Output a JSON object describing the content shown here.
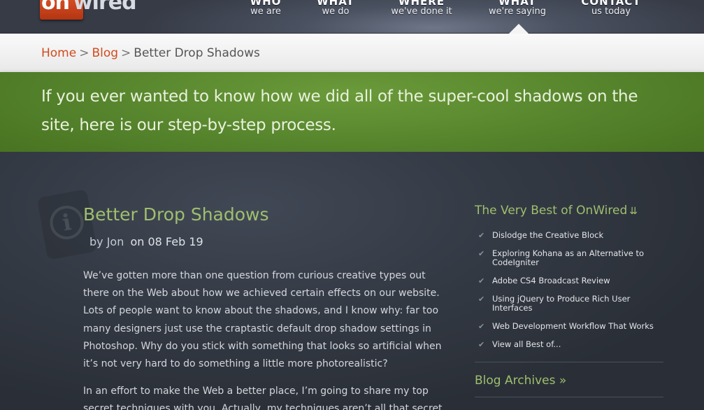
{
  "logo": {
    "mark": "on",
    "rest": "wired"
  },
  "nav": [
    {
      "main": "WHO",
      "sub": "we are"
    },
    {
      "main": "WHAT",
      "sub": "we do"
    },
    {
      "main": "WHERE",
      "sub": "we've done it"
    },
    {
      "main": "WHAT",
      "sub": "we're saying"
    },
    {
      "main": "CONTACT",
      "sub": "us today"
    }
  ],
  "breadcrumb": {
    "home": "Home",
    "blog": "Blog",
    "sep": ">",
    "current": "Better Drop Shadows"
  },
  "intro": "If you ever wanted to know how we did all of the super-cool shadows on the site, here is our step-by-step process.",
  "post": {
    "title": "Better Drop Shadows",
    "by": "by Jon",
    "on": "on 08 Feb 19",
    "p1": "We’ve gotten more than one question from curious creative types out there on the Web about how we achieved certain effects on our website. Lots of people want to know about the shadows, and I know why: far too many designers just use the craptastic default drop shadow settings in Photoshop. Why do you stick with something that looks so artificial when it’s not very hard to do something a little more photorealistic?",
    "p2": "In an effort to make the Web a better place, I’m going to share my top secret techniques with you. Actually, my techniques aren’t all that secret"
  },
  "sidebar": {
    "title": "The Very Best of OnWired",
    "chevron": "»",
    "items": [
      "Dislodge the Creative Block",
      "Exploring Kohana as an Alternative to CodeIgniter",
      "Adobe CS4 Broadcast Review",
      "Using jQuery to Produce Rich User Interfaces",
      "Web Development Workflow That Works",
      "View all Best of..."
    ],
    "archives": "Blog Archives",
    "archives_chevron": "»"
  }
}
